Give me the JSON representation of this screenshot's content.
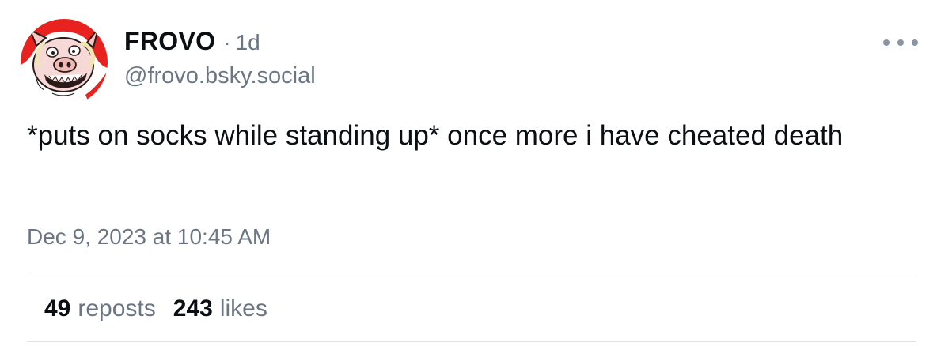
{
  "author": {
    "display_name": "FROVO",
    "handle": "@frovo.bsky.social",
    "avatar_icon": "pig-face-avatar"
  },
  "post": {
    "separator": "·",
    "age": "1d",
    "text": "*puts on socks while standing up* once more i have cheated death",
    "timestamp": "Dec 9, 2023 at 10:45 AM"
  },
  "stats": {
    "reposts_count": "49",
    "reposts_label": "reposts",
    "likes_count": "243",
    "likes_label": "likes"
  },
  "menu": {
    "icon": "more-options-icon"
  },
  "colors": {
    "text_primary": "#0b0f14",
    "text_secondary": "#6b7684",
    "divider": "#dfe3e8",
    "avatar_red": "#e8231f"
  }
}
